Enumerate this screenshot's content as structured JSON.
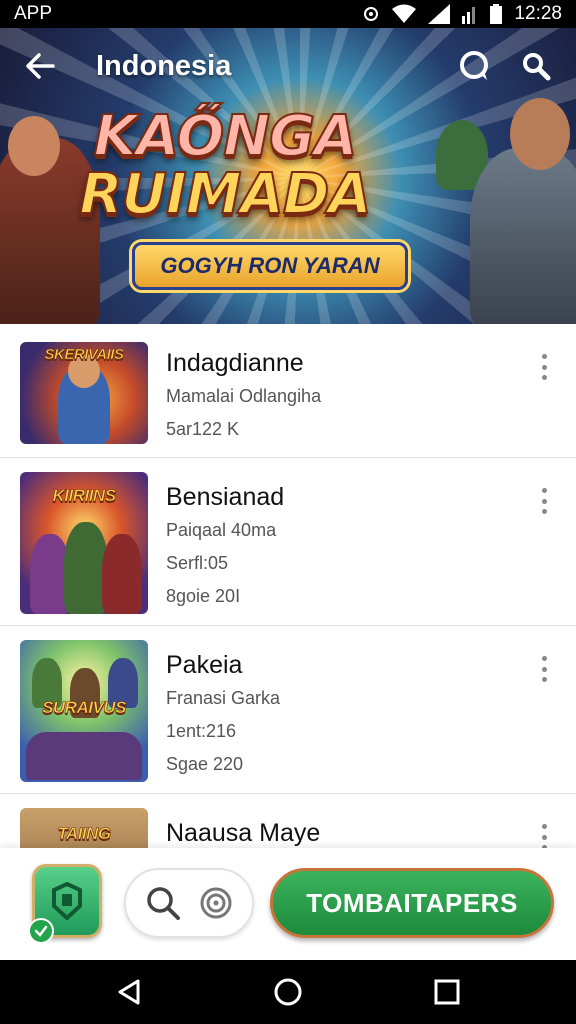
{
  "status_bar": {
    "app_label": "APP",
    "time": "12:28"
  },
  "header": {
    "region_title": "Indonesia"
  },
  "hero": {
    "title_line1": "KAŐNGA",
    "title_line2": "RUIMADA",
    "subtitle": "GOGYH RON YARAN"
  },
  "list": {
    "items": [
      {
        "title": "Indagdianne",
        "lines": [
          "Mamalai Odlangiha",
          "5ar122 K"
        ],
        "thumb_label": "SKERIVAIIS"
      },
      {
        "title": "Bensianad",
        "lines": [
          "Paiqaal 40ma",
          "Serfl:05",
          "8goie 20I"
        ],
        "thumb_label": "KIIRIINS"
      },
      {
        "title": "Pakeia",
        "lines": [
          "Franasi Garka",
          "1ent:216",
          "Sgae 220"
        ],
        "thumb_label": "SURAIVUS"
      },
      {
        "title": "Naausa Maye",
        "lines": [],
        "thumb_label": "TAIING"
      }
    ]
  },
  "action_bar": {
    "primary_label": "TOMBAITAPERS"
  },
  "colors": {
    "primary_green": "#1d8a3c",
    "accent_orange": "#c7743a"
  }
}
